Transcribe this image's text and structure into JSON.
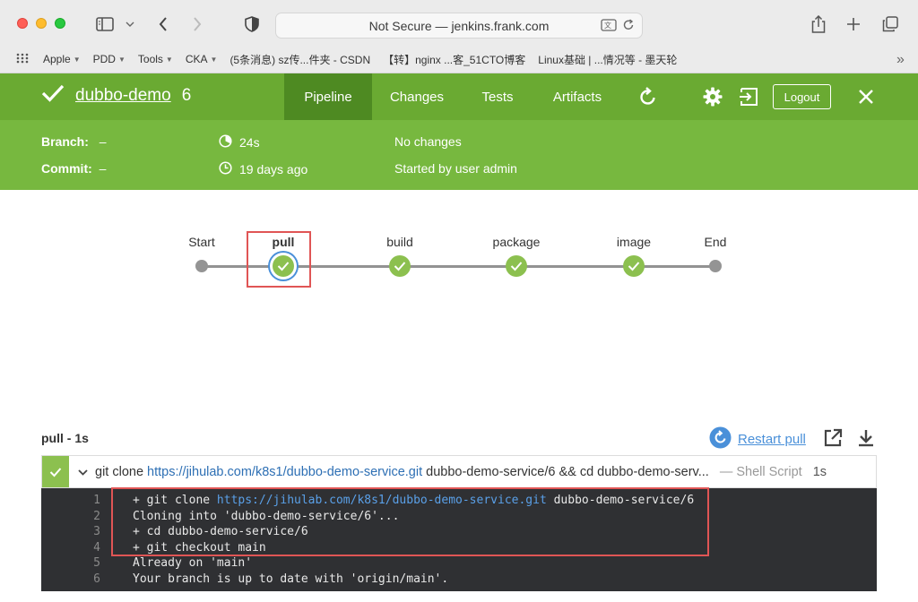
{
  "browser": {
    "address": "Not Secure — jenkins.frank.com",
    "bookmarks": [
      "Apple",
      "PDD",
      "Tools",
      "CKA",
      "(5条消息) sz传...件夹 - CSDN",
      "【转】nginx ...客_51CTO博客",
      "Linux基础 | ...情况等 - 墨天轮"
    ]
  },
  "header": {
    "job_name": "dubbo-demo",
    "build_number": "6",
    "tabs": [
      "Pipeline",
      "Changes",
      "Tests",
      "Artifacts"
    ],
    "active_tab": "Pipeline",
    "logout_label": "Logout"
  },
  "summary": {
    "branch_label": "Branch:",
    "branch_value": "–",
    "commit_label": "Commit:",
    "commit_value": "–",
    "duration": "24s",
    "time_ago": "19 days ago",
    "changes": "No changes",
    "started_by": "Started by user admin"
  },
  "pipeline": {
    "stages": [
      "Start",
      "pull",
      "build",
      "package",
      "image",
      "End"
    ],
    "selected": "pull"
  },
  "log": {
    "title": "pull - 1s",
    "restart_label": "Restart pull",
    "step": {
      "cmd_prefix": "git clone ",
      "cmd_link": "https://jihulab.com/k8s1/dubbo-demo-service.git",
      "cmd_suffix": " dubbo-demo-service/6 && cd dubbo-demo-serv...",
      "kind": "— Shell Script",
      "duration": "1s"
    },
    "lines": [
      {
        "num": "1",
        "pre": "+ git clone ",
        "link": "https://jihulab.com/k8s1/dubbo-demo-service.git",
        "post": " dubbo-demo-service/6"
      },
      {
        "num": "2",
        "pre": "Cloning into 'dubbo-demo-service/6'...",
        "link": "",
        "post": ""
      },
      {
        "num": "3",
        "pre": "+ cd dubbo-demo-service/6",
        "link": "",
        "post": ""
      },
      {
        "num": "4",
        "pre": "+ git checkout main",
        "link": "",
        "post": ""
      },
      {
        "num": "5",
        "pre": "Already on 'main'",
        "link": "",
        "post": ""
      },
      {
        "num": "6",
        "pre": "Your branch is up to date with 'origin/main'.",
        "link": "",
        "post": ""
      }
    ]
  },
  "colors": {
    "header_green": "#6aaa32",
    "sub_green": "#77b83f",
    "success": "#8cc04f",
    "selected_ring": "#4a90d9",
    "highlight_box": "#e05555"
  }
}
